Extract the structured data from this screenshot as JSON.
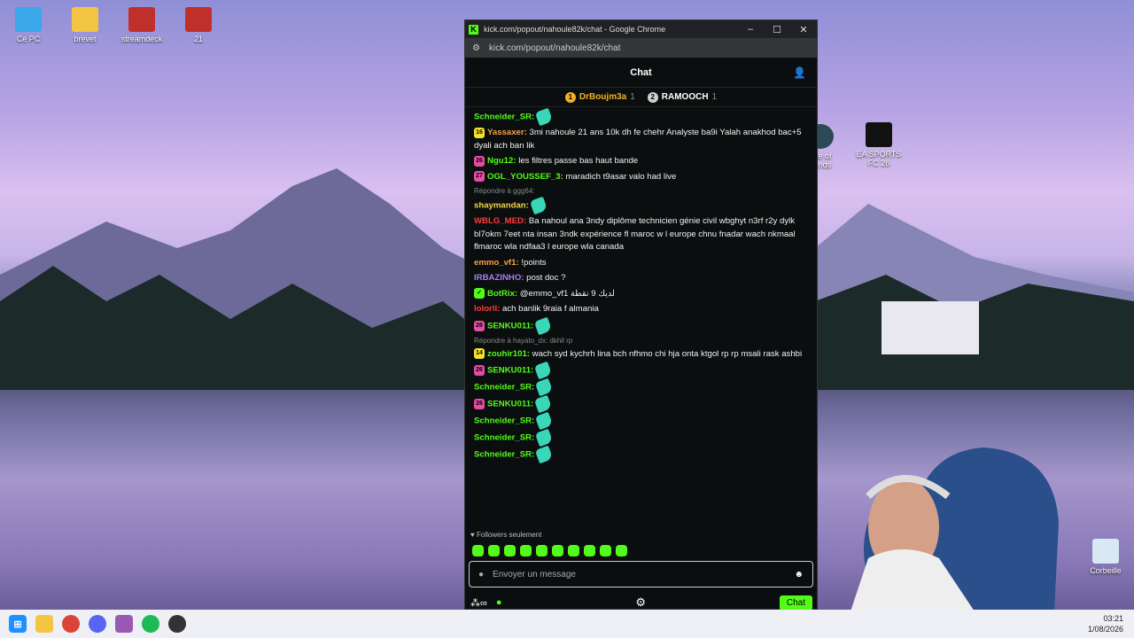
{
  "desktop_icons": [
    {
      "label": "Ce PC",
      "color": "#3aa8e8"
    },
    {
      "label": "brevet",
      "color": "#f4c542"
    },
    {
      "label": "streamdeck",
      "color": "#c0302a"
    },
    {
      "label": "21",
      "color": "#c0302a"
    },
    {
      "label": "EA SPORTS FC 26",
      "color": "#111111"
    },
    {
      "label": "Corbeille",
      "color": "#d8e8f4"
    },
    {
      "label": "gue of\ngends",
      "color": "#2a4a55"
    }
  ],
  "window": {
    "title": "kick.com/popout/nahoule82k/chat - Google Chrome",
    "url": "kick.com/popout/nahoule82k/chat",
    "controls": [
      "–",
      "☐",
      "✕"
    ]
  },
  "chat": {
    "header": "Chat",
    "pinned": [
      {
        "rank": "1",
        "name": "DrBoujm3a",
        "count": "1",
        "color": "#f2b124"
      },
      {
        "rank": "2",
        "name": "RAMOOCH",
        "count": "1",
        "color": "#cfcfcf"
      }
    ],
    "messages": [
      {
        "badge": "",
        "user": "Schneider_SR:",
        "color": "#53fc18",
        "text": "",
        "emote": true
      },
      {
        "badge": "16",
        "badge_color": "#f4e22a",
        "user": "Yassaxer:",
        "color": "#f4a24a",
        "text": "3mi nahoule 21 ans 10k dh fe chehr Analyste ba9i Yalah anakhod bac+5 dyali ach ban lik"
      },
      {
        "badge": "26",
        "badge_color": "#e94ba4",
        "user": "Ngu12:",
        "color": "#53fc18",
        "text": "les filtres passe bas haut bande"
      },
      {
        "badge": "27",
        "badge_color": "#e94ba4",
        "user": "OGL_YOUSSEF_3:",
        "color": "#53fc18",
        "text": "maradich t9asar valo had live"
      },
      {
        "reply": "Répondre à ggg64:",
        "user": "shaymandan:",
        "color": "#f4d44a",
        "text": "",
        "emote": true
      },
      {
        "badge": "",
        "user": "WBLG_MED:",
        "color": "#ff3b3b",
        "text": "Ba nahoul ana 3ndy diplôme technicien génie civil wbghyt n3rf r2y dylk bl7okm 7eet nta insan 3ndk expérience fl maroc w l europe chnu fnadar wach nkmaal flmaroc wla ndfaa3 l europe wla canada"
      },
      {
        "badge": "",
        "user": "emmo_vf1:",
        "color": "#f4a24a",
        "text": "!points"
      },
      {
        "badge": "",
        "user": "IRBAZINHO:",
        "color": "#a97cf2",
        "text": "post doc ?"
      },
      {
        "badge": "✓",
        "badge_color": "#53fc18",
        "user": "BotRix:",
        "color": "#53fc18",
        "text": "@emmo_vf1 لديك 9 نقطة"
      },
      {
        "badge": "",
        "user": "lolorll:",
        "color": "#ff3b3b",
        "text": "ach banlik 9raia f almania"
      },
      {
        "badge": "26",
        "badge_color": "#e94ba4",
        "user": "SENKU011:",
        "color": "#53fc18",
        "text": "",
        "emote": true
      },
      {
        "reply": "Répondre à hayato_dx: dkhll rp",
        "badge": "14",
        "badge_color": "#f4e22a",
        "user": "zouhir101:",
        "color": "#53fc18",
        "text": "wach syd kychrh lina bch nfhmo chi hja onta ktgol rp rp msali rask ashbi"
      },
      {
        "badge": "26",
        "badge_color": "#e94ba4",
        "user": "SENKU011:",
        "color": "#53fc18",
        "text": "",
        "emote": true
      },
      {
        "badge": "",
        "user": "Schneider_SR:",
        "color": "#53fc18",
        "text": "",
        "emote": true
      },
      {
        "badge": "26",
        "badge_color": "#e94ba4",
        "user": "SENKU011:",
        "color": "#53fc18",
        "text": "",
        "emote": true
      },
      {
        "badge": "",
        "user": "Schneider_SR:",
        "color": "#53fc18",
        "text": "",
        "emote": true
      },
      {
        "badge": "",
        "user": "Schneider_SR:",
        "color": "#53fc18",
        "text": "",
        "emote": true
      },
      {
        "badge": "",
        "user": "Schneider_SR:",
        "color": "#53fc18",
        "text": "",
        "emote": true
      }
    ],
    "followers_only": "Followers seulement",
    "input_placeholder": "Envoyer un message",
    "send_label": "Chat"
  },
  "taskbar": {
    "time": "03:21",
    "date": "1/08/2026"
  }
}
